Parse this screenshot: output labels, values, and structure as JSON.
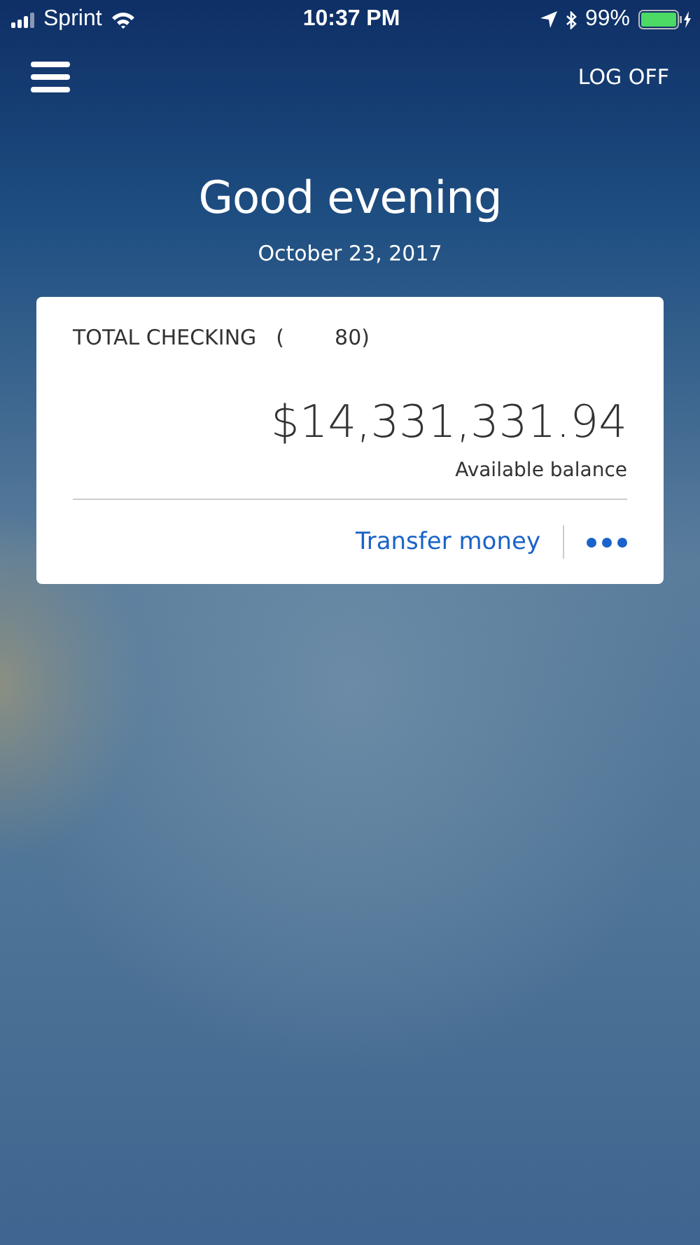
{
  "status_bar": {
    "carrier": "Sprint",
    "time": "10:37 PM",
    "battery": "99%"
  },
  "header": {
    "logoff": "LOG OFF"
  },
  "greeting": {
    "title": "Good evening",
    "date": "October 23, 2017"
  },
  "account": {
    "name": "TOTAL CHECKING",
    "number_parts": [
      "(",
      "80)"
    ],
    "balance": "$14,331,331.94",
    "balance_label": "Available balance",
    "action": "Transfer money"
  }
}
